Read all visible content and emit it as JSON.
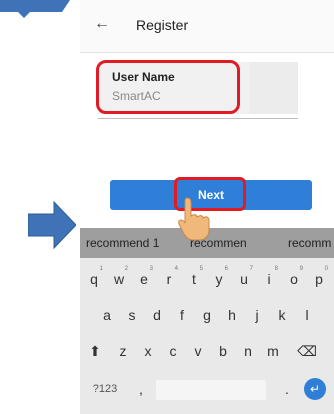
{
  "app": {
    "title": "Register",
    "back_icon": "arrow-left-icon"
  },
  "form": {
    "username_label": "User Name",
    "username_value": "SmartAC",
    "next_label": "Next"
  },
  "suggestions": [
    "recommend 1",
    "recommen",
    "recomm"
  ],
  "keyboard": {
    "row1": [
      {
        "key": "q",
        "hint": "1"
      },
      {
        "key": "w",
        "hint": "2"
      },
      {
        "key": "e",
        "hint": "3"
      },
      {
        "key": "r",
        "hint": "4"
      },
      {
        "key": "t",
        "hint": "5"
      },
      {
        "key": "y",
        "hint": "6"
      },
      {
        "key": "u",
        "hint": "7"
      },
      {
        "key": "i",
        "hint": "8"
      },
      {
        "key": "o",
        "hint": "9"
      },
      {
        "key": "p",
        "hint": "0"
      }
    ],
    "row2": [
      "a",
      "s",
      "d",
      "f",
      "g",
      "h",
      "j",
      "k",
      "l"
    ],
    "row3": [
      "z",
      "x",
      "c",
      "v",
      "b",
      "n",
      "m"
    ],
    "symbols_label": "?123",
    "comma_label": ",",
    "period_label": "."
  },
  "colors": {
    "accent": "#2f7ed8",
    "highlight": "#e01b24",
    "arrow": "#3f73b8"
  }
}
